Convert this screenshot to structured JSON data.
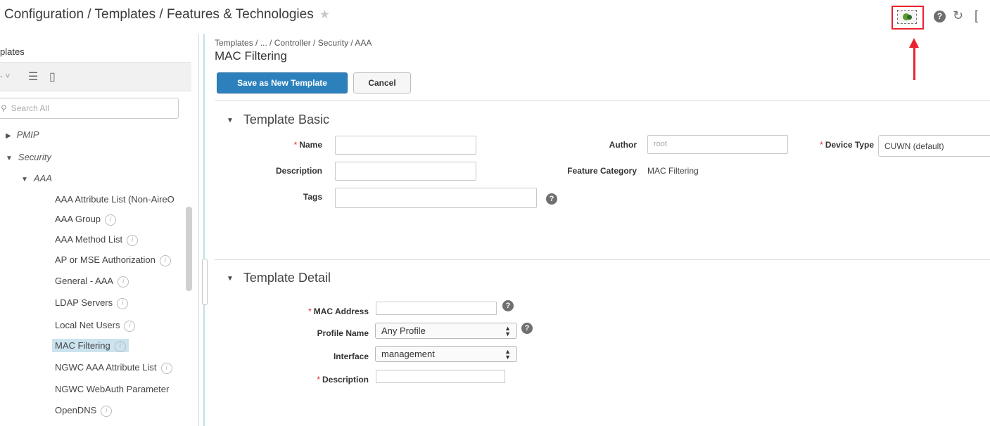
{
  "header": {
    "title": "Configuration / Templates / Features & Technologies",
    "star_icon": "star-icon",
    "icons": [
      "share-icon",
      "help-icon",
      "refresh-icon",
      "bracket-icon"
    ],
    "highlight_color": "#e8232f"
  },
  "sidebar": {
    "title": "plates",
    "search_placeholder": "Search All",
    "tree": [
      {
        "label": "PMIP",
        "expanded": false,
        "level": 1
      },
      {
        "label": "Security",
        "expanded": true,
        "level": 1
      },
      {
        "label": "AAA",
        "expanded": true,
        "level": 2
      },
      {
        "label": "AAA Attribute List (Non-AireO",
        "level": 3
      },
      {
        "label": "AAA Group",
        "level": 3,
        "info": true
      },
      {
        "label": "AAA Method List",
        "level": 3,
        "info": true
      },
      {
        "label": "AP or MSE Authorization",
        "level": 3,
        "info": true
      },
      {
        "label": "General - AAA",
        "level": 3,
        "info": true
      },
      {
        "label": "LDAP Servers",
        "level": 3,
        "info": true
      },
      {
        "label": "Local Net Users",
        "level": 3,
        "info": true
      },
      {
        "label": "MAC Filtering",
        "level": 3,
        "info": true,
        "selected": true
      },
      {
        "label": "NGWC AAA Attribute List",
        "level": 3,
        "info": true
      },
      {
        "label": "NGWC WebAuth Parameter",
        "level": 3
      },
      {
        "label": "OpenDNS",
        "level": 3,
        "info": true
      }
    ]
  },
  "main": {
    "breadcrumb": "Templates / ... / Controller / Security / AAA",
    "title": "MAC Filtering",
    "save_button": "Save as New Template",
    "cancel_button": "Cancel",
    "basic": {
      "section_title": "Template Basic",
      "name_label": "Name",
      "description_label": "Description",
      "tags_label": "Tags",
      "author_label": "Author",
      "author_value": "root",
      "feature_category_label": "Feature Category",
      "feature_category_value": "MAC Filtering",
      "device_type_label": "Device Type",
      "device_type_value": "CUWN (default)"
    },
    "detail": {
      "section_title": "Template Detail",
      "mac_label": "MAC Address",
      "profile_label": "Profile Name",
      "profile_value": "Any Profile",
      "interface_label": "Interface",
      "interface_value": "management",
      "description_label": "Description"
    }
  }
}
